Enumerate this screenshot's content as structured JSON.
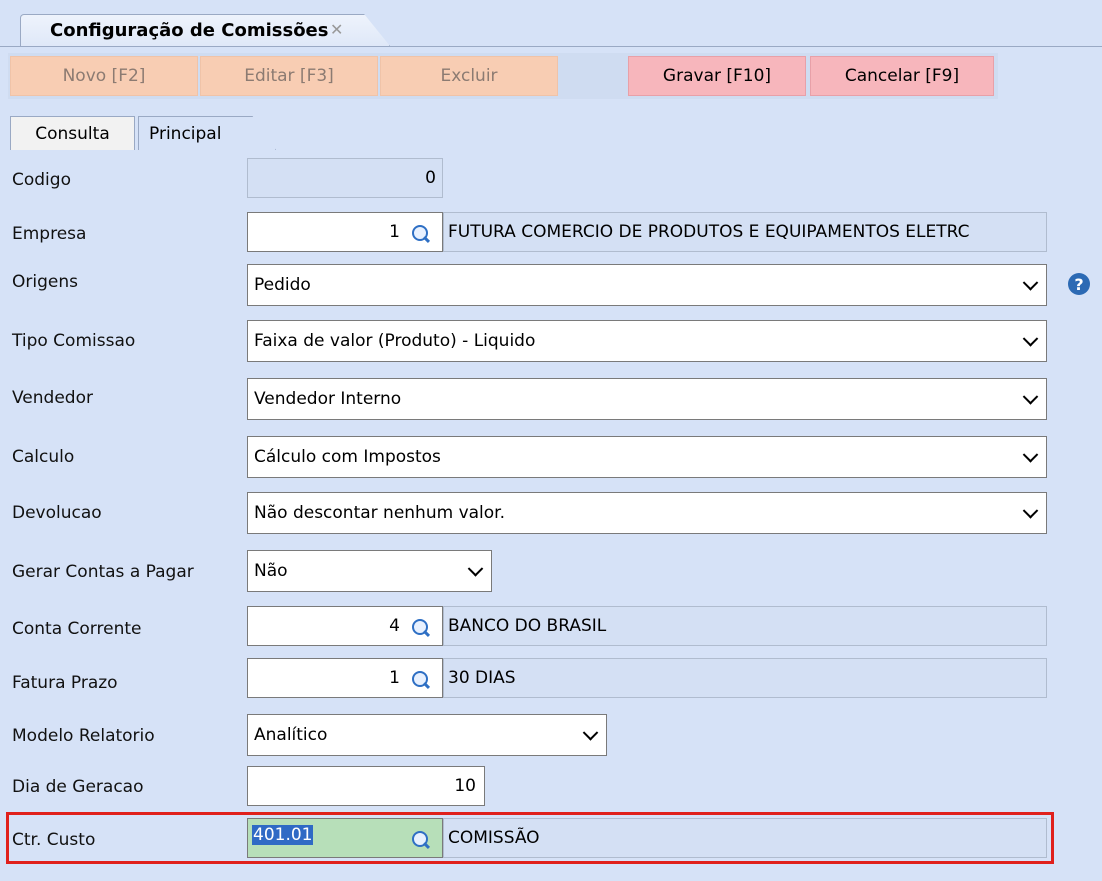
{
  "window": {
    "tab_title": "Configuração de Comissões",
    "close_glyph": "✕"
  },
  "toolbar": {
    "novo": "Novo [F2]",
    "editar": "Editar [F3]",
    "excluir": "Excluir",
    "gravar": "Gravar [F10]",
    "cancelar": "Cancelar [F9]"
  },
  "tabs": {
    "consulta": "Consulta",
    "principal": "Principal"
  },
  "form": {
    "codigo": {
      "label": "Codigo",
      "value": "0"
    },
    "empresa": {
      "label": "Empresa",
      "code": "1",
      "description": "FUTURA COMERCIO DE PRODUTOS E EQUIPAMENTOS ELETRC"
    },
    "origens": {
      "label": "Origens",
      "value": "Pedido"
    },
    "tipo_comissao": {
      "label": "Tipo Comissao",
      "value": "Faixa de valor (Produto) - Liquido"
    },
    "vendedor": {
      "label": "Vendedor",
      "value": "Vendedor Interno"
    },
    "calculo": {
      "label": "Calculo",
      "value": "Cálculo com Impostos"
    },
    "devolucao": {
      "label": "Devolucao",
      "value": "Não descontar nenhum valor."
    },
    "gerar_contas": {
      "label": "Gerar Contas a Pagar",
      "value": "Não"
    },
    "conta_corrente": {
      "label": "Conta Corrente",
      "code": "4",
      "description": "BANCO DO BRASIL"
    },
    "fatura_prazo": {
      "label": "Fatura Prazo",
      "code": "1",
      "description": "30 DIAS"
    },
    "modelo_relatorio": {
      "label": "Modelo Relatorio",
      "value": "Analítico"
    },
    "dia_geracao": {
      "label": "Dia de Geracao",
      "value": "10"
    },
    "ctr_custo": {
      "label": "Ctr. Custo",
      "code": "401.01",
      "description": "COMISSÃO"
    }
  },
  "colors": {
    "background": "#d6e2f7",
    "highlight_border": "#e0201c",
    "action_button": "#f7b6bc",
    "disabled_button": "#f8cdb3"
  },
  "icons": {
    "help": "?",
    "lookup": "magnifier-icon"
  }
}
